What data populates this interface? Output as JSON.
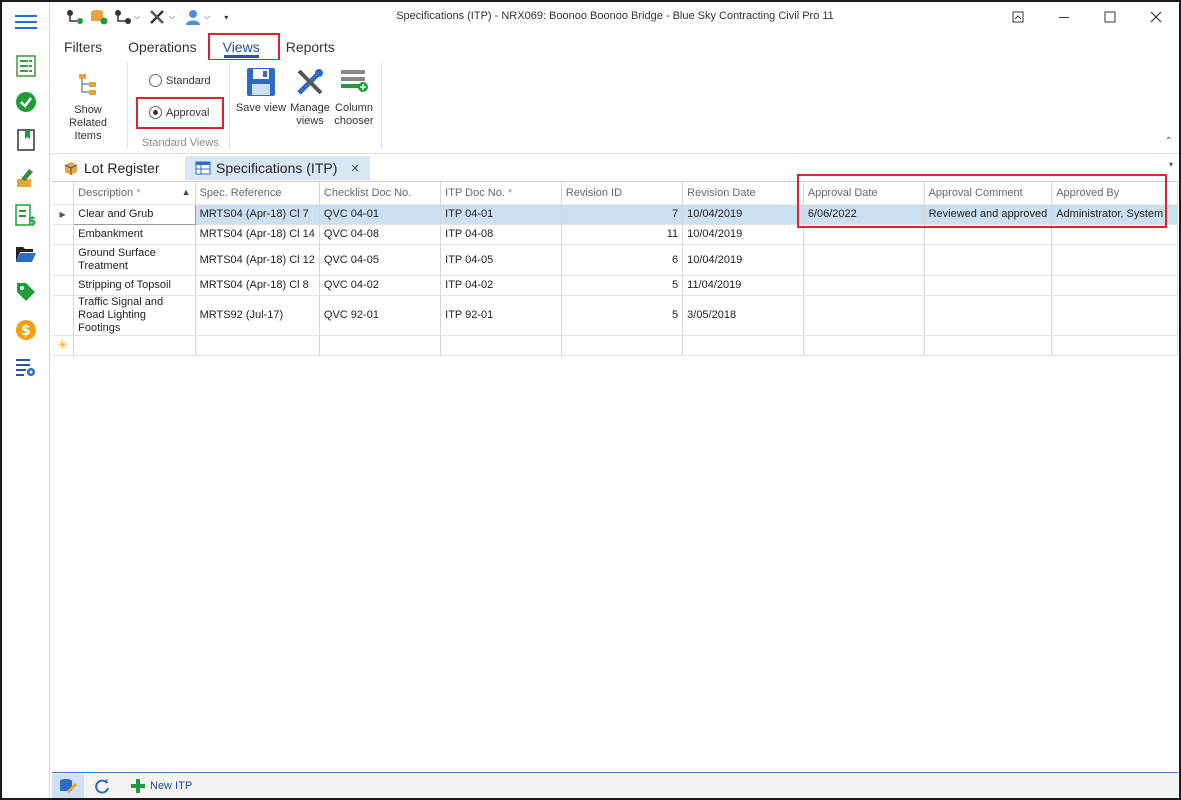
{
  "window": {
    "title": "Specifications (ITP) - NRX069: Boonoo Boonoo Bridge  - Blue Sky Contracting Civil Pro 11"
  },
  "ribbon": {
    "tabs": [
      {
        "label": "Filters"
      },
      {
        "label": "Operations"
      },
      {
        "label": "Views"
      },
      {
        "label": "Reports"
      }
    ],
    "active_tab": "Views",
    "show_related": "Show Related Items",
    "standard_views": {
      "label": "Standard Views",
      "options": [
        "Standard",
        "Approval"
      ],
      "selected": "Approval"
    },
    "save_view": "Save view",
    "manage_views": "Manage views",
    "column_chooser": "Column chooser"
  },
  "doc_tabs": [
    {
      "label": "Lot Register"
    },
    {
      "label": "Specifications (ITP)"
    }
  ],
  "grid": {
    "columns": [
      "Description",
      "Spec. Reference",
      "Checklist Doc No.",
      "ITP Doc No.",
      "Revision ID",
      "Revision Date",
      "Approval Date",
      "Approval Comment",
      "Approved By"
    ],
    "rows": [
      {
        "desc": "Clear and Grub",
        "spec": "MRTS04 (Apr-18) Cl 7",
        "checklist": "QVC 04-01",
        "itp": "ITP 04-01",
        "rev": "7",
        "rev_date": "10/04/2019",
        "appr_date": "6/06/2022",
        "appr_comment": "Reviewed and approved",
        "appr_by": "Administrator, System"
      },
      {
        "desc": "Embankment",
        "spec": "MRTS04 (Apr-18) Cl 14",
        "checklist": "QVC 04-08",
        "itp": "ITP 04-08",
        "rev": "11",
        "rev_date": "10/04/2019",
        "appr_date": "",
        "appr_comment": "",
        "appr_by": ""
      },
      {
        "desc": "Ground Surface Treatment",
        "spec": "MRTS04 (Apr-18) Cl 12",
        "checklist": "QVC 04-05",
        "itp": "ITP 04-05",
        "rev": "6",
        "rev_date": "10/04/2019",
        "appr_date": "",
        "appr_comment": "",
        "appr_by": ""
      },
      {
        "desc": "Stripping of Topsoil",
        "spec": "MRTS04 (Apr-18) Cl 8",
        "checklist": "QVC 04-02",
        "itp": "ITP 04-02",
        "rev": "5",
        "rev_date": "11/04/2019",
        "appr_date": "",
        "appr_comment": "",
        "appr_by": ""
      },
      {
        "desc": "Traffic Signal and Road Lighting Footings",
        "spec": "MRTS92 (Jul-17)",
        "checklist": "QVC 92-01",
        "itp": "ITP 92-01",
        "rev": "5",
        "rev_date": "3/05/2018",
        "appr_date": "",
        "appr_comment": "",
        "appr_by": ""
      }
    ]
  },
  "statusbar": {
    "new_itp": "New ITP"
  },
  "colors": {
    "accent": "#2b579a",
    "highlight": "#d9252b",
    "selection": "#cde0f2"
  }
}
